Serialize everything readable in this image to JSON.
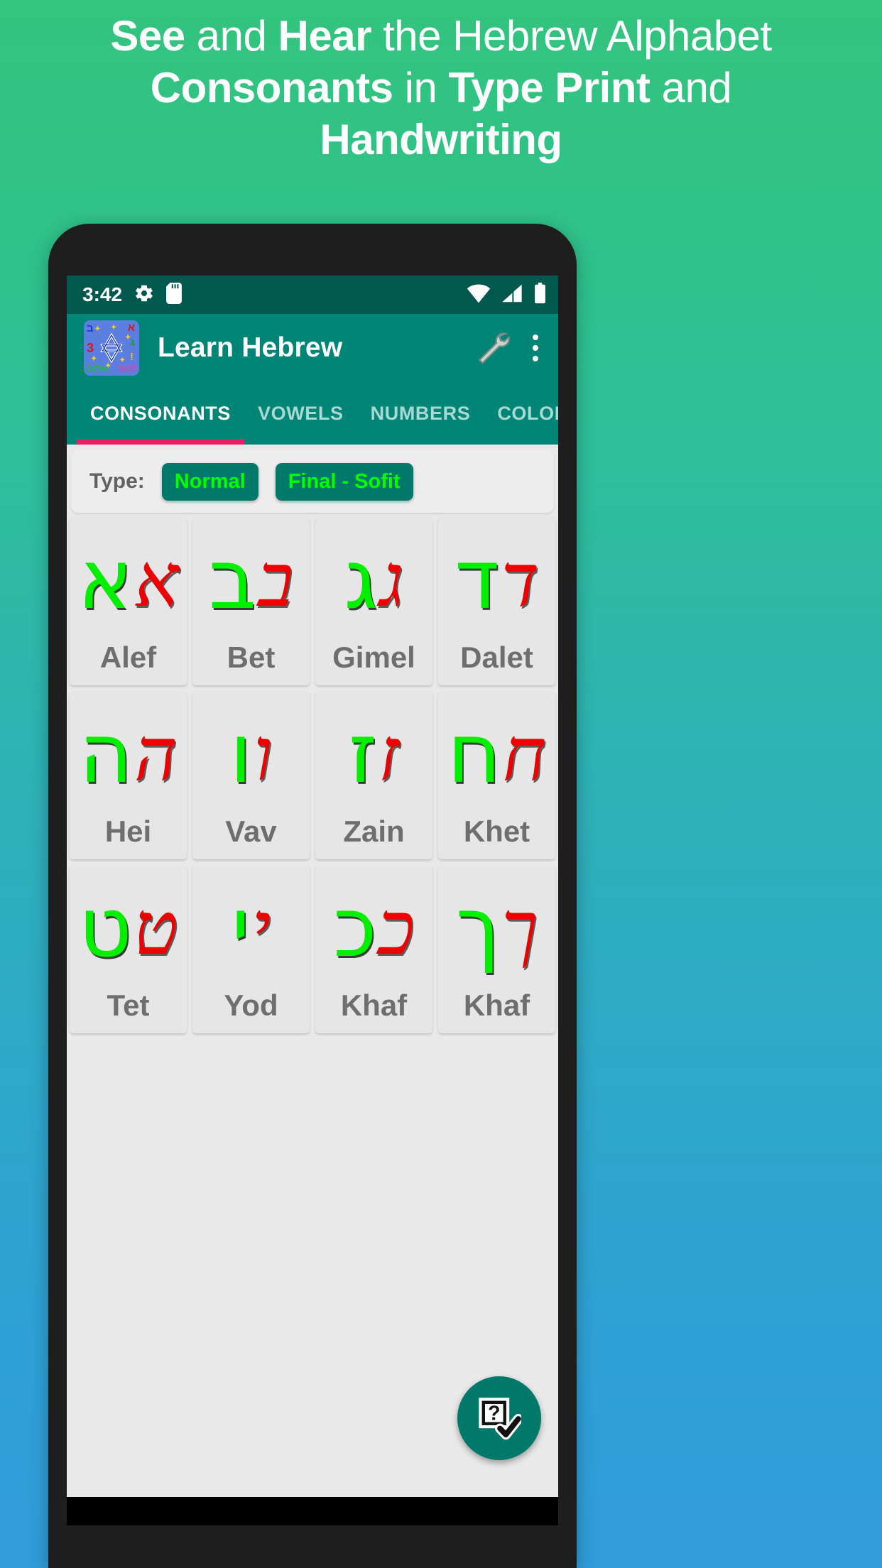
{
  "promo": {
    "line1_pre": "See",
    "line1_mid": " and ",
    "line1_bold2": "Hear",
    "line1_post": " the Hebrew Alphabet",
    "line2_bold": "Consonants",
    "line2_mid": " in ",
    "line2_bold2": "Type Print",
    "line2_post": " and",
    "line3": "Handwriting",
    "full_text": "See and Hear the Hebrew Alphabet Consonants in Type Print and Handwriting"
  },
  "status_bar": {
    "time": "3:42",
    "icons_left": [
      "gear-icon",
      "sd-card-icon"
    ],
    "icons_right": [
      "wifi-icon",
      "cellular-signal-icon",
      "battery-icon"
    ]
  },
  "app_bar": {
    "app_icon": "learn-hebrew-app-icon",
    "title": "Learn Hebrew",
    "actions": [
      {
        "name": "wrench-icon",
        "label": "Settings"
      },
      {
        "name": "overflow-menu-icon",
        "label": "More options"
      }
    ]
  },
  "tabs": {
    "active_index": 0,
    "items": [
      {
        "label": "CONSONANTS"
      },
      {
        "label": "VOWELS"
      },
      {
        "label": "NUMBERS"
      },
      {
        "label": "COLORS"
      }
    ]
  },
  "type_bar": {
    "label": "Type:",
    "buttons": [
      {
        "label": "Normal"
      },
      {
        "label": "Final - Sofit"
      }
    ]
  },
  "colors": {
    "accent_teal": "#008577",
    "dark_teal": "#00584f",
    "tab_indicator_pink": "#e91e63",
    "print_green": "#00f000",
    "hand_red": "#ee0000",
    "card_grey": "#e6e6e6",
    "label_grey": "#6e6e6e",
    "promo_top_green": "#33c47d",
    "promo_bottom_blue": "#309cd9"
  },
  "letters": [
    {
      "name": "Alef",
      "print": "א",
      "hand": "א"
    },
    {
      "name": "Bet",
      "print": "ב",
      "hand": "ב"
    },
    {
      "name": "Gimel",
      "print": "ג",
      "hand": "ג"
    },
    {
      "name": "Dalet",
      "print": "ד",
      "hand": "ד"
    },
    {
      "name": "Hei",
      "print": "ה",
      "hand": "ה"
    },
    {
      "name": "Vav",
      "print": "ו",
      "hand": "ו"
    },
    {
      "name": "Zain",
      "print": "ז",
      "hand": "ז"
    },
    {
      "name": "Khet",
      "print": "ח",
      "hand": "ח"
    },
    {
      "name": "Tet",
      "print": "ט",
      "hand": "ט"
    },
    {
      "name": "Yod",
      "print": "י",
      "hand": "י"
    },
    {
      "name": "Khaf",
      "print": "כ",
      "hand": "כ"
    },
    {
      "name": "Khaf",
      "print": "ך",
      "hand": "ך"
    }
  ],
  "fab": {
    "name": "quiz-icon",
    "label": "Quiz"
  }
}
